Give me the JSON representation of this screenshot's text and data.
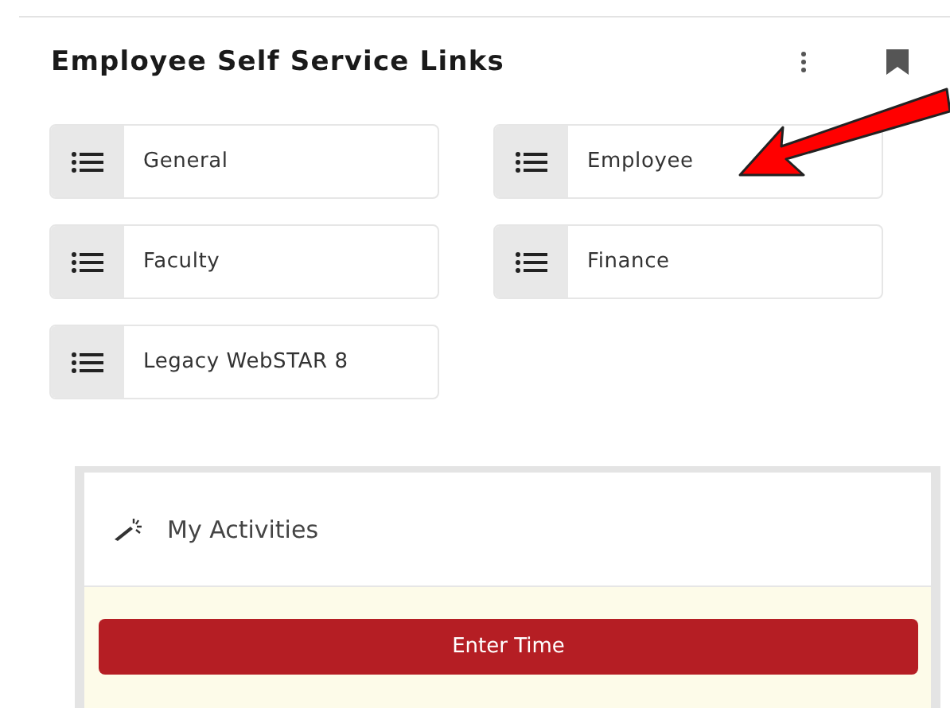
{
  "header": {
    "title": "Employee Self Service Links"
  },
  "links": [
    {
      "label": "General"
    },
    {
      "label": "Employee"
    },
    {
      "label": "Faculty"
    },
    {
      "label": "Finance"
    },
    {
      "label": "Legacy WebSTAR 8"
    }
  ],
  "activities": {
    "title": "My Activities",
    "button": "Enter Time"
  }
}
